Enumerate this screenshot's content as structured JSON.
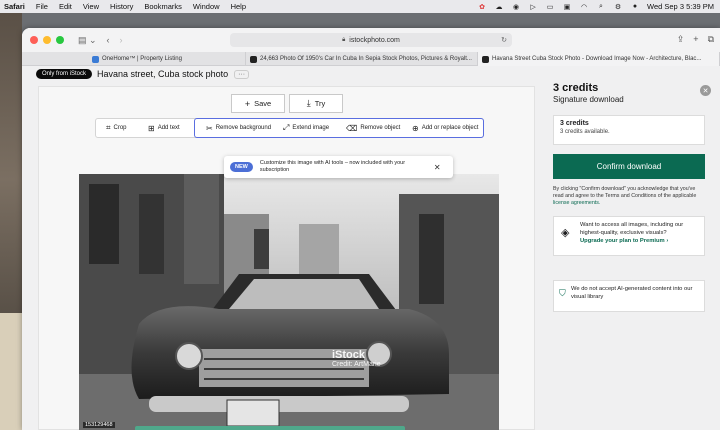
{
  "menubar": {
    "app": "Safari",
    "items": [
      "File",
      "Edit",
      "View",
      "History",
      "Bookmarks",
      "Window",
      "Help"
    ],
    "datetime": "Wed Sep 3  5:39 PM"
  },
  "browser": {
    "url": "istockphoto.com",
    "tabs": [
      {
        "title": "OneHome™ | Property Listing"
      },
      {
        "title": "24,663 Photo Of 1950's Car In Cuba In Sepia Stock Photos, Pictures & Royalt..."
      },
      {
        "title": "Havana Street Cuba Stock Photo - Download Image Now - Architecture, Blac..."
      }
    ]
  },
  "header": {
    "badge": "Only from iStock",
    "title": "Havana street, Cuba stock photo",
    "more": "···"
  },
  "editor": {
    "save_label": "Save",
    "try_label": "Try",
    "tools": {
      "crop": "Crop",
      "add_text": "Add text",
      "remove_background": "Remove background",
      "extend_image": "Extend image",
      "remove_object": "Remove object",
      "add_replace_object": "Add or replace object"
    },
    "popup": {
      "badge": "NEW",
      "text": "Customize this image with AI tools – now included with your subscription"
    },
    "image": {
      "id": "153129468",
      "watermark": "iStock",
      "credit": "Credit: ArtMarie"
    }
  },
  "panel": {
    "credits_title": "3 credits",
    "download_type": "Signature download",
    "box_title": "3 credits",
    "box_sub": "3 credits available.",
    "confirm_label": "Confirm download",
    "legal_text": "By clicking \"Confirm download\" you acknowledge that you've read and agree to the Terms and Conditions of the applicable",
    "legal_link": "license agreements.",
    "premium_text": "Want to access all images, including our highest-quality, exclusive visuals?",
    "premium_link": "Upgrade your plan to Premium ›",
    "ai_notice": "We do not accept AI-generated content into our visual library"
  },
  "colors": {
    "confirm": "#0b6a52",
    "ai_outline": "#5a6ee0",
    "new_badge": "#4c6fd6"
  }
}
